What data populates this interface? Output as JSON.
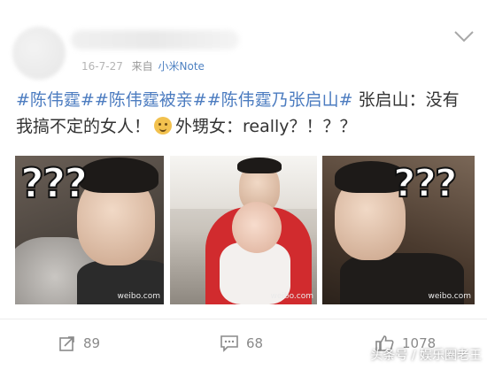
{
  "post": {
    "meta": {
      "date": "16-7-27",
      "source_prefix": "来自",
      "device": "小米Note"
    },
    "text": {
      "tags": [
        "#陈伟霆#",
        "#陈伟霆被亲#",
        "#陈伟霆乃张启山#"
      ],
      "line1_rest": " 张启山：没有",
      "line2_a": "我搞不定的女人！",
      "line2_b": "外甥女：really？！？？"
    },
    "emoji": "smiling-face-emoji",
    "photos": [
      {
        "qmarks": "???",
        "watermark": "weibo.com"
      },
      {
        "watermark": "weibo.com"
      },
      {
        "qmarks": "???",
        "watermark": "weibo.com"
      }
    ]
  },
  "actions": {
    "repost_count": "89",
    "comment_count": "68",
    "like_count": "1078"
  },
  "overlay": {
    "watermark": "头条号 / 娱乐圈老王"
  },
  "colors": {
    "link": "#4c7cc0",
    "device": "#4f82c2",
    "muted": "#8a8a8a"
  }
}
